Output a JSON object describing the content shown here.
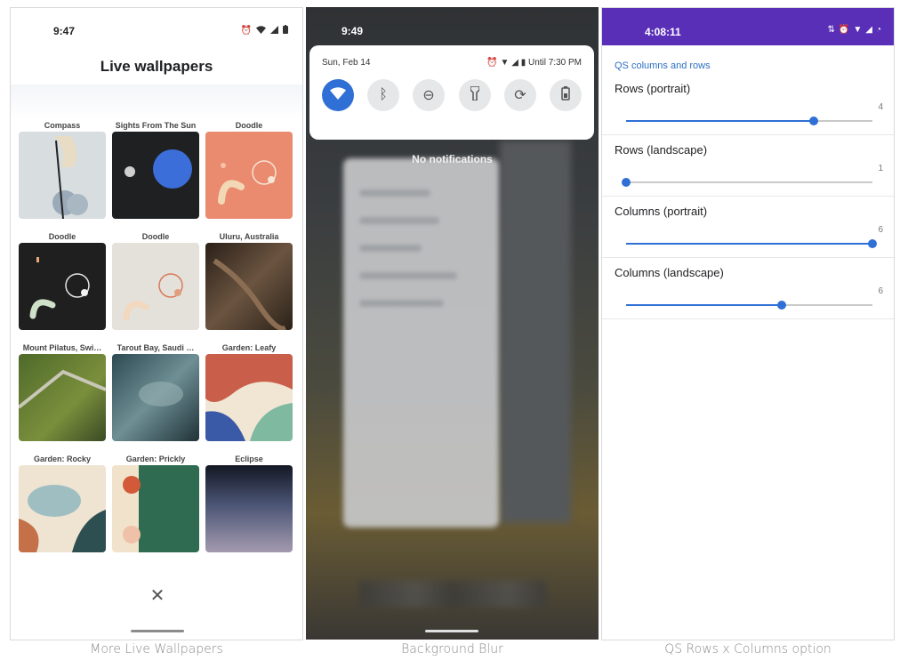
{
  "panel1": {
    "status_time": "9:47",
    "title": "Live wallpapers",
    "wallpapers": [
      {
        "label": "Compass"
      },
      {
        "label": "Sights From The Sun"
      },
      {
        "label": "Doodle"
      },
      {
        "label": "Doodle"
      },
      {
        "label": "Doodle"
      },
      {
        "label": "Uluru, Australia"
      },
      {
        "label": "Mount Pilatus, Swi…"
      },
      {
        "label": "Tarout Bay, Saudi …"
      },
      {
        "label": "Garden: Leafy"
      },
      {
        "label": "Garden: Rocky"
      },
      {
        "label": "Garden: Prickly"
      },
      {
        "label": "Eclipse"
      }
    ],
    "close_icon": "close-icon",
    "caption": "More Live Wallpapers"
  },
  "panel2": {
    "status_time": "9:49",
    "date": "Sun, Feb 14",
    "battery_text": "Until 7:30 PM",
    "tiles": [
      "wifi-icon",
      "bluetooth-icon",
      "do-not-disturb-icon",
      "flashlight-icon",
      "auto-rotate-icon",
      "battery-saver-icon"
    ],
    "no_notifications": "No notifications",
    "caption": "Background Blur"
  },
  "panel3": {
    "status_time": "4:08:11",
    "section_title": "QS columns and rows",
    "prefs": [
      {
        "title": "Rows (portrait)",
        "value": "4",
        "level": 0.76
      },
      {
        "title": "Rows (landscape)",
        "value": "1",
        "level": 0.0
      },
      {
        "title": "Columns (portrait)",
        "value": "6",
        "level": 1.0
      },
      {
        "title": "Columns (landscape)",
        "value": "6",
        "level": 0.63
      }
    ],
    "caption": "QS Rows x Columns option"
  },
  "colors": {
    "accent_blue": "#2f6fd6",
    "status_purple": "#5a2fb8",
    "section_blue": "#2d6fc4"
  }
}
